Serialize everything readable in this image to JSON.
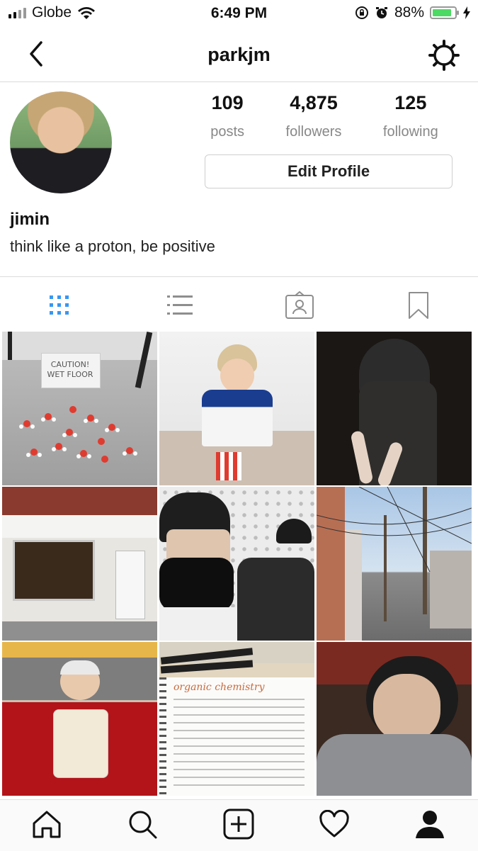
{
  "status_bar": {
    "carrier": "Globe",
    "time": "6:49 PM",
    "battery_percent": "88%",
    "battery_level": 0.88,
    "battery_color": "#4cd964",
    "icons": [
      "signal-icon",
      "wifi-icon",
      "rotation-lock-icon",
      "alarm-icon",
      "battery-icon",
      "charging-bolt-icon"
    ]
  },
  "nav": {
    "title": "parkjm",
    "back_icon": "chevron-left-icon",
    "settings_icon": "gear-icon"
  },
  "profile": {
    "stats": [
      {
        "value": "109",
        "label": "posts"
      },
      {
        "value": "4,875",
        "label": "followers"
      },
      {
        "value": "125",
        "label": "following"
      }
    ],
    "edit_button": "Edit Profile",
    "name": "jimin",
    "bio": "think like a proton, be positive"
  },
  "tabs": {
    "active_color": "#3897f0",
    "items": [
      "grid-view-icon",
      "list-view-icon",
      "tagged-icon",
      "saved-bookmark-icon"
    ],
    "active": 0
  },
  "posts": {
    "captions": {
      "caution_sign": "CAUTION! WET FLOOR",
      "notebook": "organic chemistry"
    }
  },
  "tab_bar": {
    "items": [
      "home-icon",
      "search-icon",
      "new-post-icon",
      "activity-heart-icon",
      "profile-icon"
    ]
  }
}
